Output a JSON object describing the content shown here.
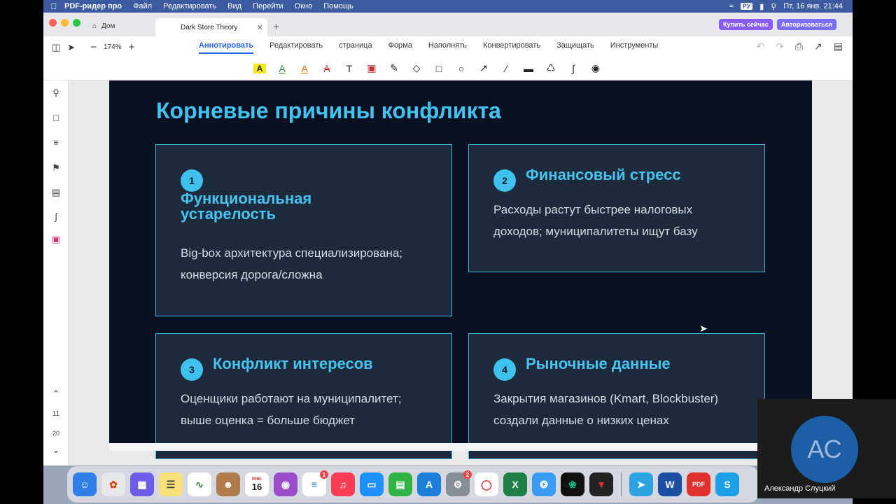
{
  "menubar": {
    "app_name": "PDF-ридер про",
    "items": [
      "Файл",
      "Редактировать",
      "Вид",
      "Перейти",
      "Окно",
      "Помощь"
    ],
    "input_lang": "РУ",
    "datetime": "Пт, 16 янв.  21:44"
  },
  "tabs": {
    "home_label": "Дом",
    "doc_label": "Dark Store Theory",
    "buy_label": "Купить сейчас",
    "login_label": "Авторизоваться"
  },
  "toolbar": {
    "zoom": "174%",
    "menu_items": [
      "Аннотировать",
      "Редактировать",
      "страница",
      "Форма",
      "Наполнять",
      "Конвертировать",
      "Защищать",
      "Инструменты"
    ]
  },
  "sidebar": {
    "page_current": "11",
    "page_total": "20"
  },
  "slide": {
    "title": "Корневые причины конфликта",
    "cards": [
      {
        "num": "1",
        "title": "Функциональная устарелость",
        "text": "Big-box архитектура специализирована; конверсия дорога/сложна"
      },
      {
        "num": "2",
        "title": "Финансовый стресс",
        "text": "Расходы растут быстрее налоговых доходов; муниципалитеты ищут базу"
      },
      {
        "num": "3",
        "title": "Конфликт интересов",
        "text": "Оценщики работают на муниципалитет; выше оценка = больше бюджет"
      },
      {
        "num": "4",
        "title": "Рыночные данные",
        "text": "Закрытия магазинов (Kmart, Blockbuster) создали данные о низких ценах"
      }
    ]
  },
  "dock": {
    "calendar_month": "ЯНВ.",
    "calendar_day": "16",
    "reminders_badge": "1",
    "sysprefs_badge": "2"
  },
  "participant": {
    "initials": "АС",
    "name": "Александр Слуцкий"
  }
}
